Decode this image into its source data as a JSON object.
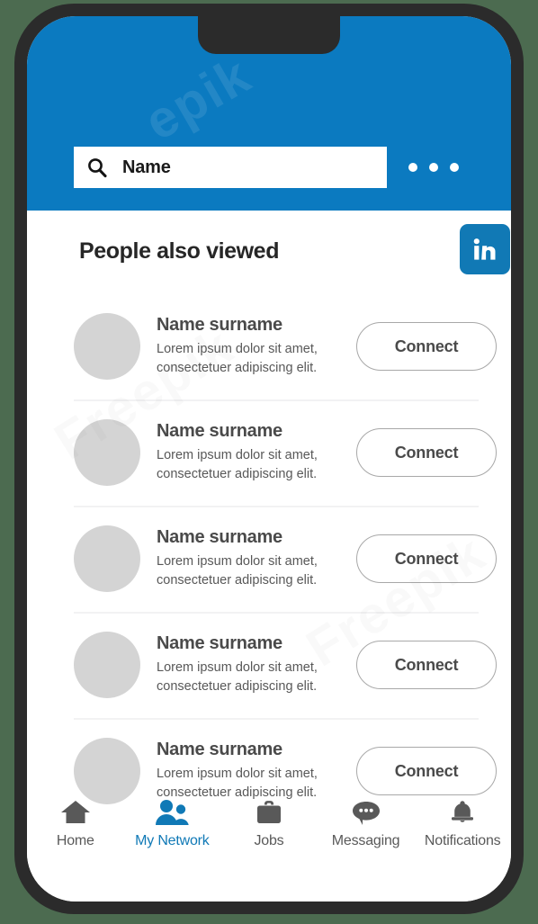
{
  "device": {
    "frame_color": "#2b2b2b",
    "background_color": "#4c6b50",
    "notch": "notch"
  },
  "header": {
    "background_color": "#0b7ac0",
    "search": {
      "value": "Name",
      "placeholder": "Name",
      "icon": "search-icon"
    },
    "more_menu": {
      "icon": "more-horizontal-icon",
      "dots": [
        "dot",
        "dot",
        "dot"
      ]
    }
  },
  "section": {
    "title": "People also viewed",
    "brand": {
      "name": "linkedin-logo",
      "mark": "in",
      "color": "#1179b5"
    }
  },
  "people": [
    {
      "name": "Name surname",
      "description_line1": "Lorem ipsum dolor sit amet,",
      "description_line2": "consectetuer adipiscing elit.",
      "action_label": "Connect",
      "avatar": "avatar-placeholder"
    },
    {
      "name": "Name surname",
      "description_line1": "Lorem ipsum dolor sit amet,",
      "description_line2": "consectetuer adipiscing elit.",
      "action_label": "Connect",
      "avatar": "avatar-placeholder"
    },
    {
      "name": "Name surname",
      "description_line1": "Lorem ipsum dolor sit amet,",
      "description_line2": "consectetuer adipiscing elit.",
      "action_label": "Connect",
      "avatar": "avatar-placeholder"
    },
    {
      "name": "Name surname",
      "description_line1": "Lorem ipsum dolor sit amet,",
      "description_line2": "consectetuer adipiscing elit.",
      "action_label": "Connect",
      "avatar": "avatar-placeholder"
    },
    {
      "name": "Name surname",
      "description_line1": "Lorem ipsum dolor sit amet,",
      "description_line2": "consectetuer adipiscing elit.",
      "action_label": "Connect",
      "avatar": "avatar-placeholder"
    }
  ],
  "bottom_nav": {
    "active_color": "#1079b6",
    "inactive_color": "#595959",
    "items": [
      {
        "label": "Home",
        "icon": "home-icon",
        "active": false
      },
      {
        "label": "My Network",
        "icon": "people-icon",
        "active": true
      },
      {
        "label": "Jobs",
        "icon": "briefcase-icon",
        "active": false
      },
      {
        "label": "Messaging",
        "icon": "chat-bubble-icon",
        "active": false
      },
      {
        "label": "Notifications",
        "icon": "bell-icon",
        "active": false
      }
    ]
  }
}
